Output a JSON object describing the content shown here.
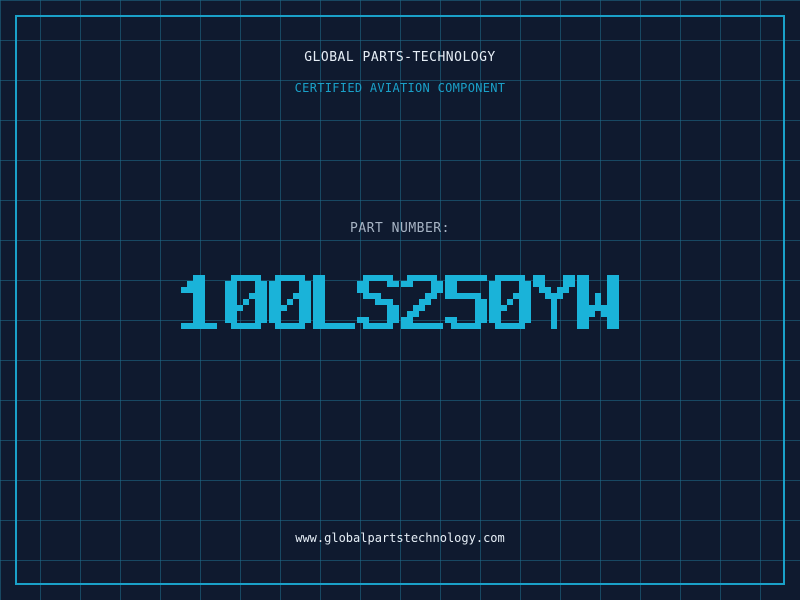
{
  "header": {
    "company": "GLOBAL PARTS-TECHNOLOGY",
    "subtitle": "CERTIFIED AVIATION COMPONENT"
  },
  "part": {
    "label": "PART NUMBER:",
    "number": "100LS250YW"
  },
  "footer": {
    "website": "www.globalpartstechnology.com"
  },
  "colors": {
    "background": "#0f1a2f",
    "grid": "#1e6e8c",
    "accent": "#1aa0c8",
    "part_number": "#1ab3d9",
    "text": "#e6eef6",
    "label": "#a8b4c4"
  }
}
